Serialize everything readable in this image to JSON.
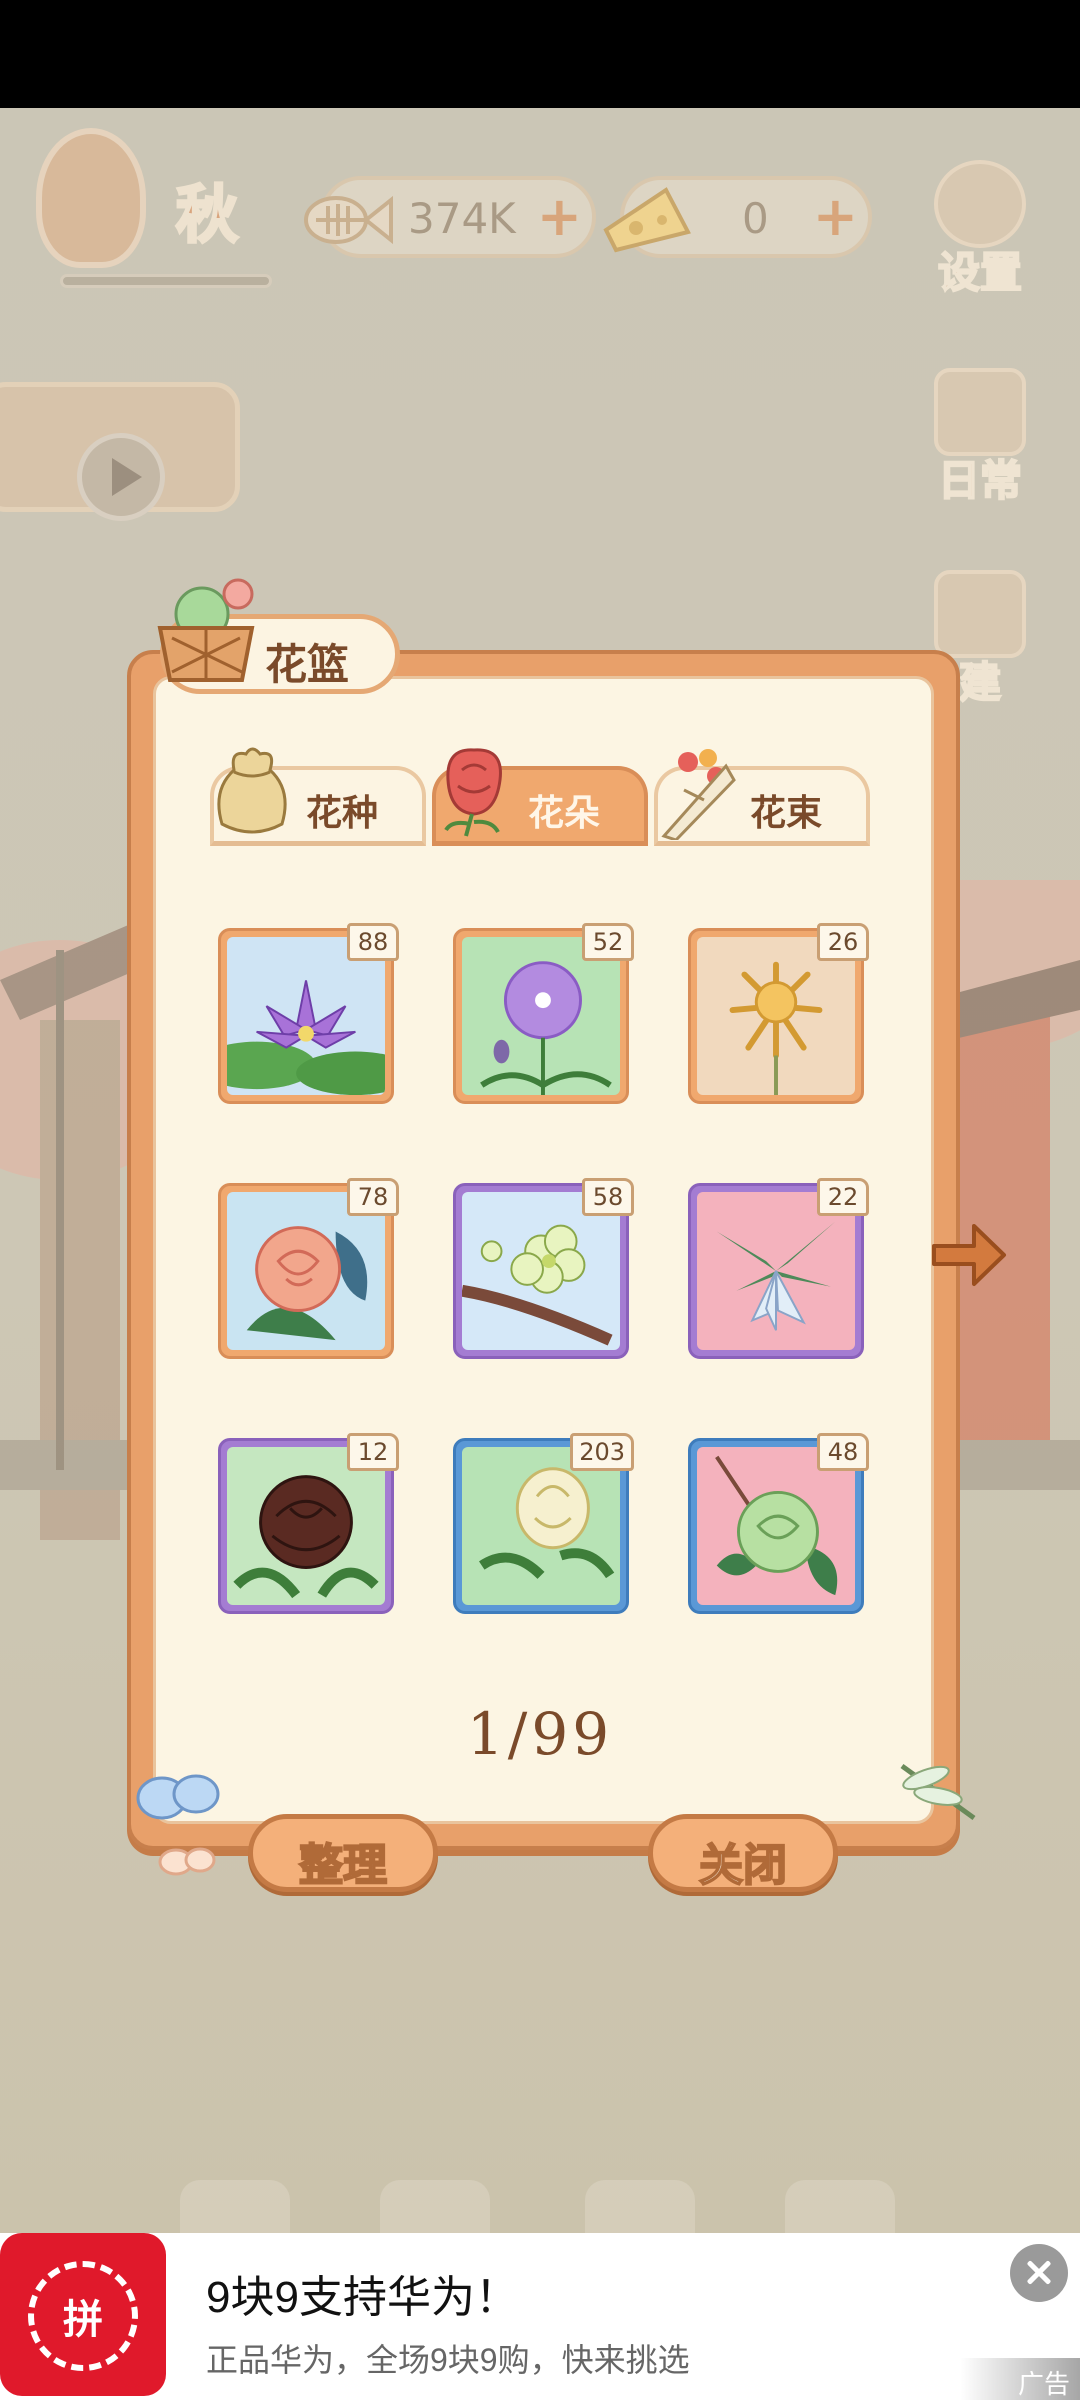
{
  "hud": {
    "season": "秋",
    "fish_value": "374K",
    "cheese_value": "0",
    "plus": "+",
    "settings_label": "设置",
    "daily_label": "日常",
    "build_label": "建"
  },
  "panel": {
    "title": "花篮",
    "tabs": [
      {
        "label": "花种",
        "icon": "seed-bag-icon"
      },
      {
        "label": "花朵",
        "icon": "rose-icon"
      },
      {
        "label": "花束",
        "icon": "bouquet-icon"
      }
    ],
    "active_tab": "花朵",
    "items": [
      {
        "name": "water-lily",
        "count": "88",
        "rarity": "orange"
      },
      {
        "name": "purple-dandelion",
        "count": "52",
        "rarity": "orange"
      },
      {
        "name": "golden-chrysanthemum",
        "count": "26",
        "rarity": "orange"
      },
      {
        "name": "rose",
        "count": "78",
        "rarity": "orange"
      },
      {
        "name": "plum-blossom",
        "count": "58",
        "rarity": "purple"
      },
      {
        "name": "lily",
        "count": "22",
        "rarity": "purple"
      },
      {
        "name": "dark-peony",
        "count": "12",
        "rarity": "purple"
      },
      {
        "name": "white-camellia",
        "count": "203",
        "rarity": "blue"
      },
      {
        "name": "green-rose",
        "count": "48",
        "rarity": "blue"
      }
    ],
    "page": "1/99",
    "sort_label": "整理",
    "close_label": "关闭"
  },
  "colors": {
    "panel_border": "#e8a06a",
    "panel_bg": "#fcf5e3",
    "rarity_orange": "#f0a86e",
    "rarity_purple": "#a47cd2",
    "rarity_blue": "#5a98d6",
    "ad_brand": "#e0192b"
  },
  "ad": {
    "logo_text": "拼",
    "title": "9块9支持华为！",
    "description": "正品华为，全场9块9购，快来挑选",
    "tag": "广告"
  }
}
